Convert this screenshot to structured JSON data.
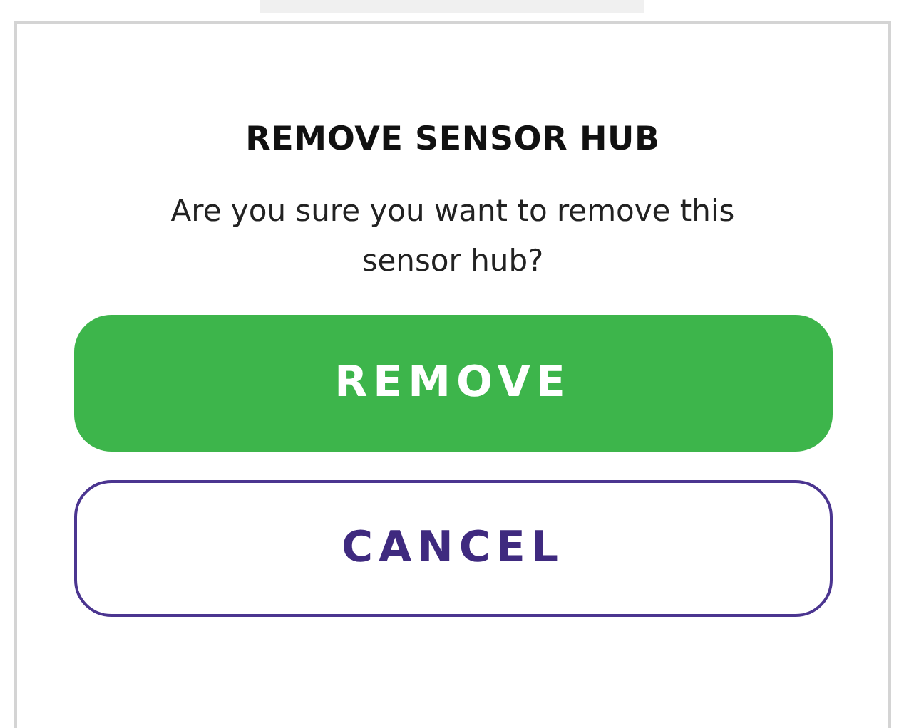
{
  "dialog": {
    "title": "REMOVE SENSOR HUB",
    "message": "Are you sure you want to remove this sensor hub?",
    "buttons": [
      {
        "label": "REMOVE",
        "kind": "primary"
      },
      {
        "label": "CANCEL",
        "kind": "secondary"
      }
    ]
  }
}
